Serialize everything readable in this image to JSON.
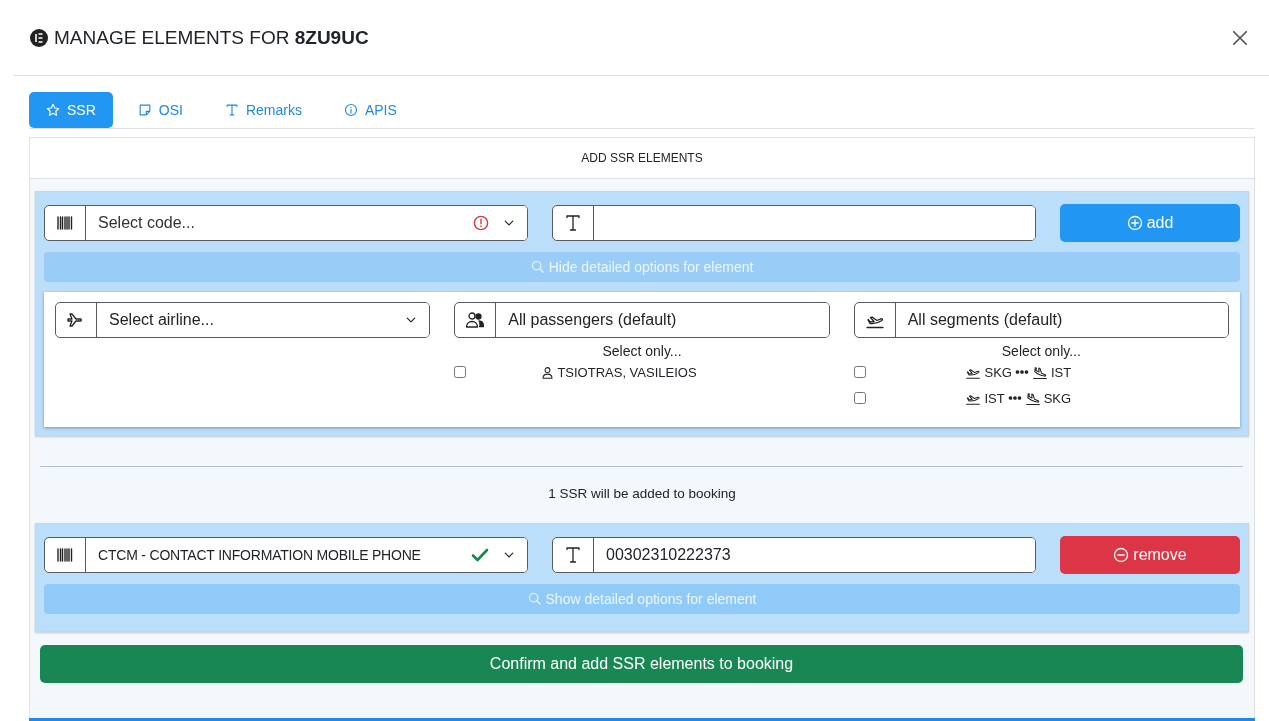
{
  "dialog": {
    "title": "MANAGE ELEMENTS FOR **8ZU9UC**"
  },
  "tabs": [
    {
      "label": "SSR",
      "kind": "star",
      "selected": true
    },
    {
      "label": "OSI",
      "kind": "note",
      "selected": false
    },
    {
      "label": "Remarks",
      "kind": "text",
      "selected": false
    },
    {
      "label": "APIS",
      "kind": "info",
      "selected": false
    }
  ],
  "add_section": {
    "heading": "ADD SSR ELEMENTS",
    "element": {
      "code_placeholder": "Select code...",
      "code_valid": false,
      "button": {
        "kind": "add",
        "label": "add"
      },
      "options_toggle": "Hide detailed options for element",
      "expanded": true,
      "airline_placeholder": "Select airline...",
      "passengers_value": "All passengers (default)",
      "passengers_hint": "Select only...",
      "passengers": [
        {
          "name": "TSIOTRAS, VASILEIOS",
          "checked": false
        }
      ],
      "segments_value": "All segments (default)",
      "segments_hint": "Select only...",
      "segments": [
        {
          "from": "SKG",
          "to": "IST",
          "checked": false
        },
        {
          "from": "IST",
          "to": "SKG",
          "checked": false
        }
      ]
    }
  },
  "summary": "1 SSR will be added to booking",
  "added": [
    {
      "code_value": "CTCM - CONTACT INFORMATION MOBILE PHONE",
      "code_valid": true,
      "text_value": "00302310222373",
      "button": {
        "kind": "remove",
        "label": "remove"
      },
      "options_toggle": "Show detailed options for element",
      "expanded": false
    }
  ],
  "confirm_button": "Confirm and add SSR elements to booking"
}
